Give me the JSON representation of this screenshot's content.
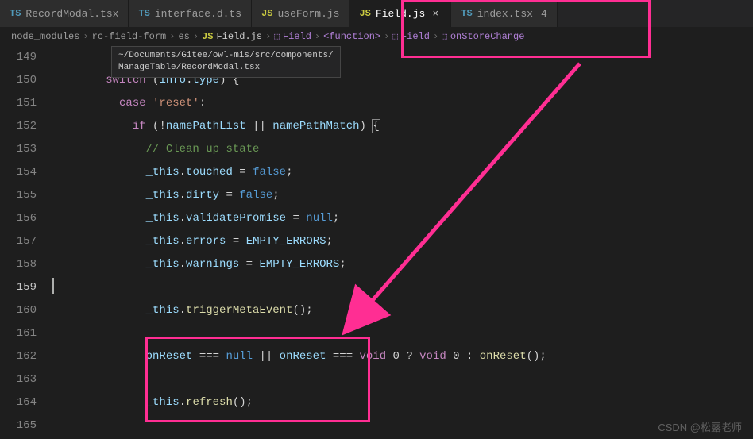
{
  "tabs": [
    {
      "icon": "TS",
      "label": "RecordModal.tsx",
      "active": false,
      "has_close": false
    },
    {
      "icon": "TS",
      "label": "interface.d.ts",
      "active": false,
      "has_close": false
    },
    {
      "icon": "JS",
      "label": "useForm.js",
      "active": false,
      "has_close": false
    },
    {
      "icon": "JS",
      "label": "Field.js",
      "active": true,
      "has_close": true
    },
    {
      "icon": "TS",
      "label": "index.tsx",
      "active": false,
      "has_close": false,
      "dirty_count": "4"
    }
  ],
  "breadcrumbs": {
    "path": [
      "node_modules",
      "rc-field-form",
      "es"
    ],
    "file_icon": "JS",
    "file": "Field.js",
    "symbols": [
      "Field",
      "<function>",
      "Field",
      "onStoreChange"
    ]
  },
  "tooltip": {
    "line1": "~/Documents/Gitee/owl-mis/src/components/",
    "line2": "ManageTable/RecordModal.tsx"
  },
  "line_start": 149,
  "line_end": 165,
  "cursor_line": 159,
  "code": {
    "l149": "",
    "l150": {
      "kw": "switch",
      "open": " (",
      "v1": "info",
      "dot": ".",
      "v2": "type",
      "close": ") {"
    },
    "l151": {
      "kw": "case",
      "str": "'reset'",
      "colon": ":"
    },
    "l152": {
      "kw": "if",
      "open": " (!",
      "v1": "namePathList",
      "or": " || ",
      "v2": "namePathMatch",
      "close": ") ",
      "brace": "{"
    },
    "l153": {
      "cmt": "// Clean up state"
    },
    "l154": {
      "obj": "_this",
      "dot": ".",
      "prop": "touched",
      "eq": " = ",
      "val": "false",
      "semi": ";"
    },
    "l155": {
      "obj": "_this",
      "dot": ".",
      "prop": "dirty",
      "eq": " = ",
      "val": "false",
      "semi": ";"
    },
    "l156": {
      "obj": "_this",
      "dot": ".",
      "prop": "validatePromise",
      "eq": " = ",
      "val": "null",
      "semi": ";"
    },
    "l157": {
      "obj": "_this",
      "dot": ".",
      "prop": "errors",
      "eq": " = ",
      "val": "EMPTY_ERRORS",
      "semi": ";"
    },
    "l158": {
      "obj": "_this",
      "dot": ".",
      "prop": "warnings",
      "eq": " = ",
      "val": "EMPTY_ERRORS",
      "semi": ";"
    },
    "l159": "",
    "l160": {
      "obj": "_this",
      "dot": ".",
      "call": "triggerMetaEvent",
      "paren": "();"
    },
    "l161": "",
    "l162": {
      "v1": "onReset",
      "op1": " === ",
      "c1": "null",
      "or": " || ",
      "v2": "onReset",
      "op2": " === ",
      "c2": "void",
      "sp": " ",
      "n1": "0",
      "q": " ? ",
      "c3": "void",
      "sp2": " ",
      "n2": "0",
      "colon": " : ",
      "call": "onReset",
      "paren": "();"
    },
    "l163": "",
    "l164": {
      "obj": "_this",
      "dot": ".",
      "call": "refresh",
      "paren": "();"
    },
    "l165": ""
  },
  "watermark": "CSDN @松露老师",
  "annotations": {
    "box_tabs": true,
    "box_block": true,
    "arrow": true
  },
  "colors": {
    "highlight": "#ff2e93"
  }
}
